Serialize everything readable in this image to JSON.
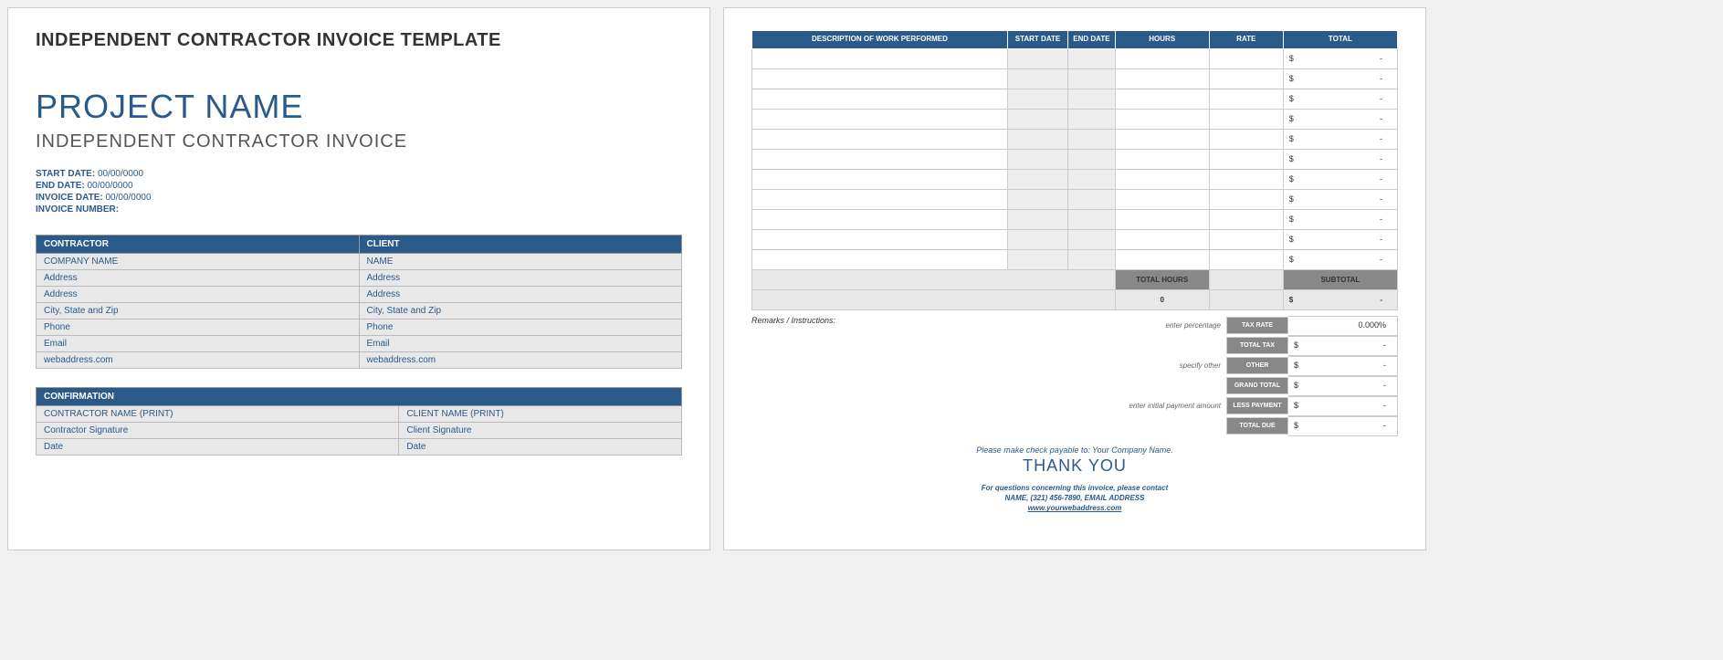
{
  "doc_title": "INDEPENDENT CONTRACTOR INVOICE TEMPLATE",
  "project_name": "PROJECT NAME",
  "subtitle": "INDEPENDENT CONTRACTOR INVOICE",
  "meta": {
    "start_label": "START DATE:",
    "start_value": "00/00/0000",
    "end_label": "END DATE:",
    "end_value": "00/00/0000",
    "invdate_label": "INVOICE DATE:",
    "invdate_value": "00/00/0000",
    "invnum_label": "INVOICE NUMBER:",
    "invnum_value": ""
  },
  "parties": {
    "contractor_header": "CONTRACTOR",
    "client_header": "CLIENT",
    "contractor": [
      "COMPANY NAME",
      "Address",
      "Address",
      "City, State and Zip",
      "Phone",
      "Email",
      "webaddress.com"
    ],
    "client": [
      "NAME",
      "Address",
      "Address",
      "City, State and Zip",
      "Phone",
      "Email",
      "webaddress.com"
    ]
  },
  "confirmation": {
    "header": "CONFIRMATION",
    "rows": [
      [
        "CONTRACTOR NAME (PRINT)",
        "CLIENT NAME (PRINT)"
      ],
      [
        "Contractor Signature",
        "Client Signature"
      ],
      [
        "Date",
        "Date"
      ]
    ]
  },
  "work": {
    "headers": [
      "DESCRIPTION OF WORK PERFORMED",
      "START DATE",
      "END DATE",
      "HOURS",
      "RATE",
      "TOTAL"
    ],
    "row_count": 11,
    "total_symbol": "$",
    "total_dash": "-",
    "total_hours_label": "TOTAL HOURS",
    "total_hours_value": "0",
    "subtotal_label": "SUBTOTAL",
    "subtotal_value_symbol": "$",
    "subtotal_value_dash": "-"
  },
  "remarks_label": "Remarks / Instructions:",
  "totals": [
    {
      "hint": "enter percentage",
      "label": "TAX RATE",
      "value_left": "",
      "value_right": "0.000%"
    },
    {
      "hint": "",
      "label": "TOTAL TAX",
      "value_left": "$",
      "value_right": "-"
    },
    {
      "hint": "specify other",
      "label": "OTHER",
      "value_left": "$",
      "value_right": "-"
    },
    {
      "hint": "",
      "label": "GRAND TOTAL",
      "value_left": "$",
      "value_right": "-"
    },
    {
      "hint": "enter initial payment amount",
      "label": "LESS PAYMENT",
      "value_left": "$",
      "value_right": "-"
    },
    {
      "hint": "",
      "label": "TOTAL DUE",
      "value_left": "$",
      "value_right": "-"
    }
  ],
  "footer": {
    "payable": "Please make check payable to: Your Company Name.",
    "thanks": "THANK YOU",
    "contact1": "For questions concerning this invoice, please contact",
    "contact2": "NAME, (321) 456-7890, EMAIL ADDRESS",
    "web": "www.yourwebaddress.com"
  }
}
